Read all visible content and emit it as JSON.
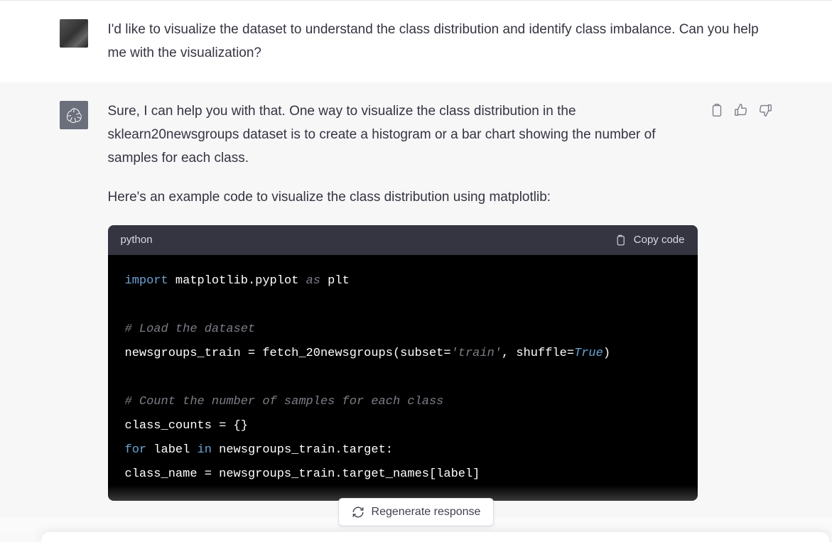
{
  "user_message": {
    "text": "I'd like to visualize the dataset to understand the class distribution and identify class imbalance. Can you help me with the visualization?"
  },
  "assistant_message": {
    "paragraph1": "Sure, I can help you with that. One way to visualize the class distribution in the sklearn20newsgroups dataset is to create a histogram or a bar chart showing the number of samples for each class.",
    "paragraph2": "Here's an example code to visualize the class distribution using matplotlib:",
    "code": {
      "language": "python",
      "copy_label": "Copy code",
      "lines": {
        "l1_kw": "import",
        "l1_mod": "matplotlib.pyplot",
        "l1_as": "as",
        "l1_alias": "plt",
        "l3_comment": "# Load the dataset",
        "l4": "newsgroups_train = fetch_20newsgroups(subset=",
        "l4_str": "'train'",
        "l4b": ", shuffle=",
        "l4_bool": "True",
        "l4c": ")",
        "l6_comment": "# Count the number of samples for each class",
        "l7": "class_counts = {}",
        "l8_kw": "for",
        "l8a": " label ",
        "l8_kw2": "in",
        "l8b": " newsgroups_train.target:",
        "l9": "    class_name = newsgroups_train.target_names[label]"
      }
    }
  },
  "regenerate_label": "Regenerate response"
}
